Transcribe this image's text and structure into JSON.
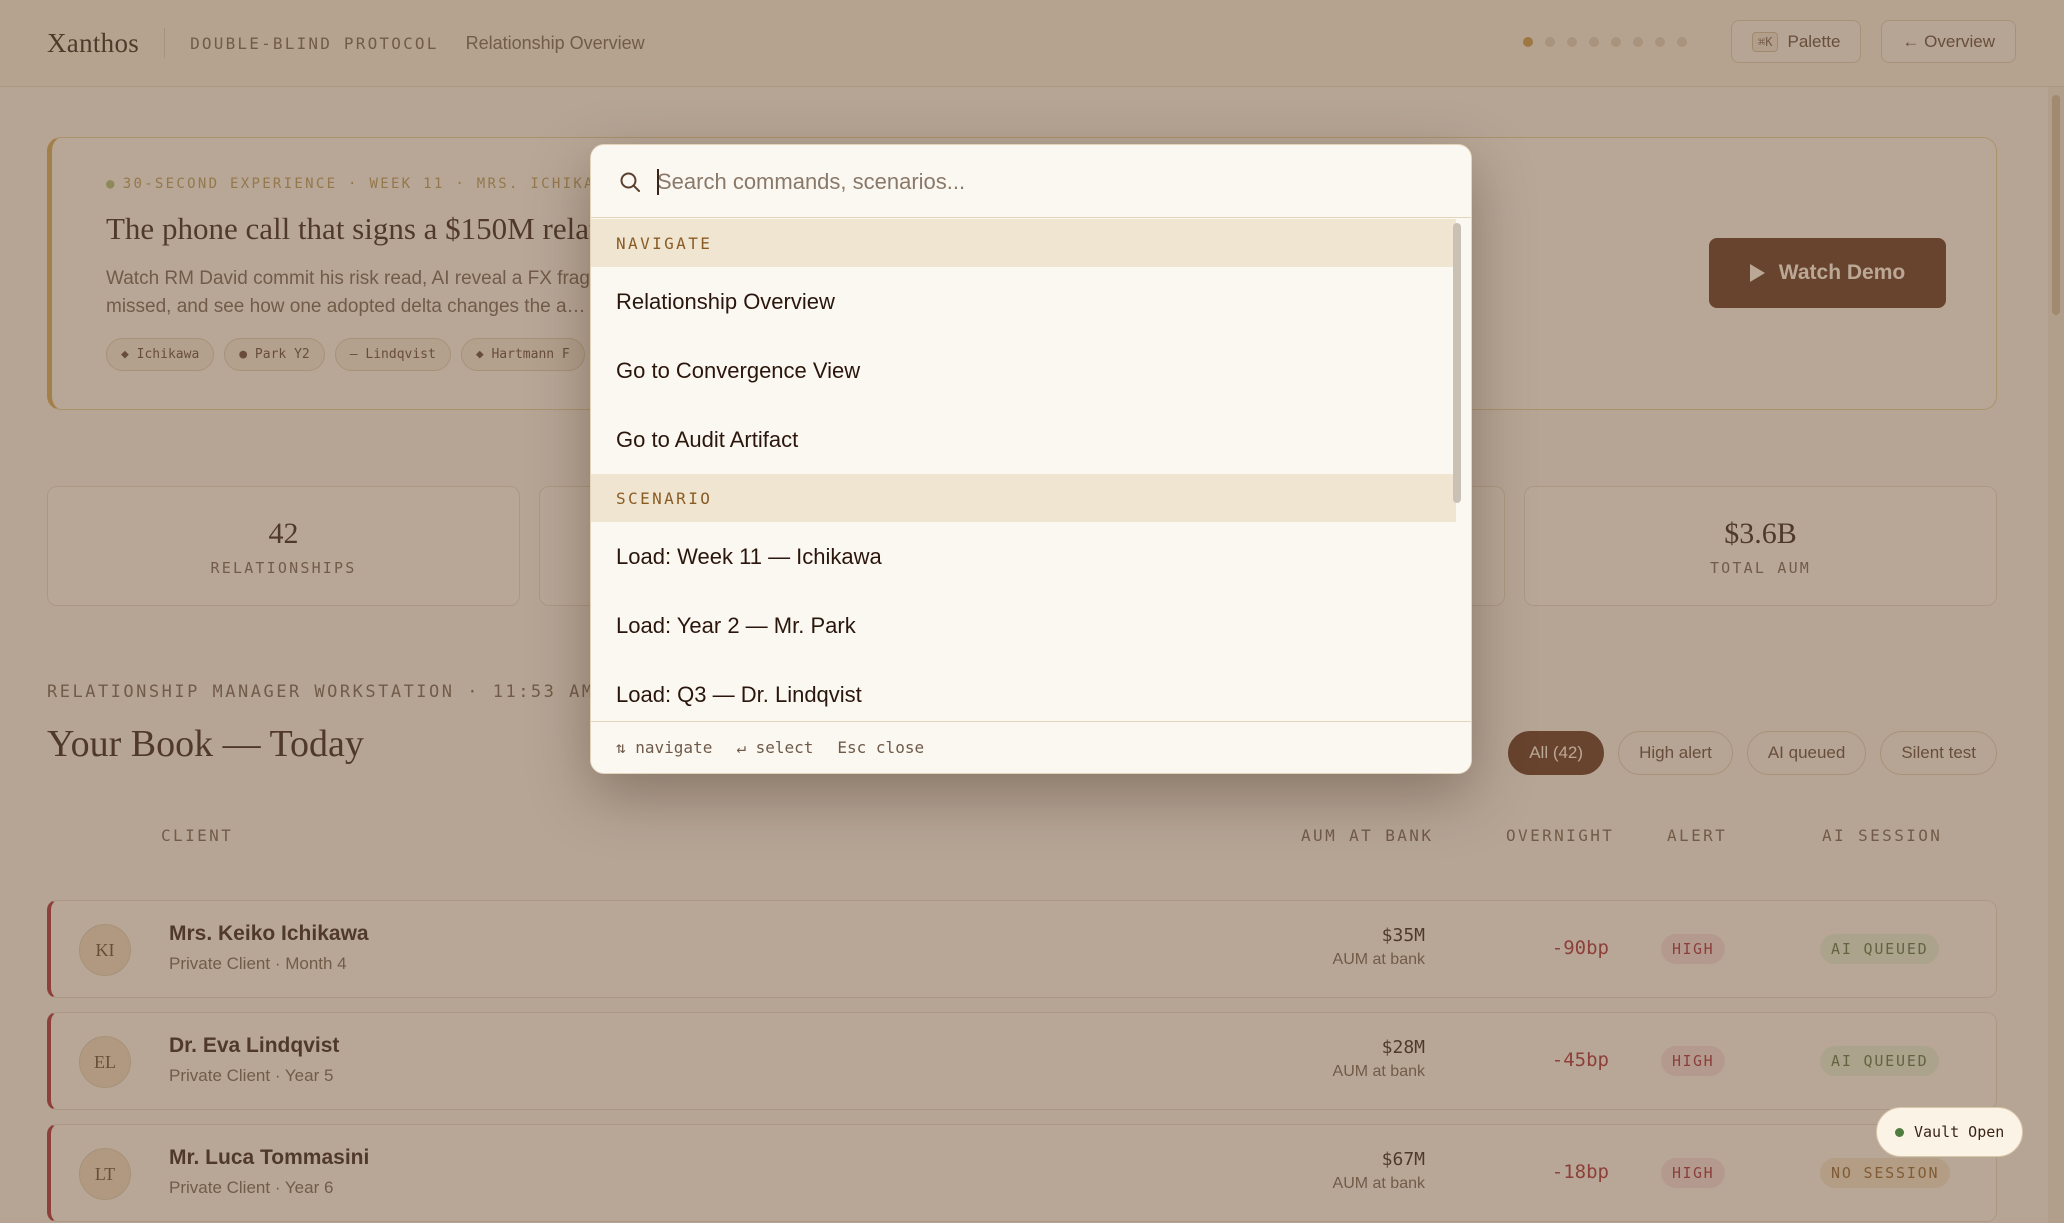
{
  "topbar": {
    "brand": "Xanthos",
    "protocol": "DOUBLE-BLIND PROTOCOL",
    "page": "Relationship Overview",
    "palette_kbd": "⌘K",
    "palette_label": "Palette",
    "overview_label": "← Overview",
    "progress": {
      "current": 1,
      "total": 8
    }
  },
  "hero": {
    "kicker": "30-SECOND EXPERIENCE · WEEK 11 · MRS. ICHIKAWA",
    "title": "The phone call that signs a $150M relationship",
    "description": "Watch RM David commit his risk read, AI reveal a FX fragility he missed, and see how one adopted delta changes the a…",
    "chips": [
      "◆ Ichikawa",
      "● Park Y2",
      "— Lindqvist",
      "◆ Hartmann F"
    ],
    "cta": "Watch Demo"
  },
  "stats": [
    {
      "value": "42",
      "label": "RELATIONSHIPS"
    },
    {
      "value": "$3.6B",
      "label": "TOTAL AUM"
    }
  ],
  "book": {
    "workstation_label": "RELATIONSHIP MANAGER WORKSTATION · 11:53 AM GMT",
    "title": "Your Book — Today",
    "filters": [
      "All (42)",
      "High alert",
      "AI queued",
      "Silent test"
    ],
    "columns": {
      "client": "CLIENT",
      "aum": "AUM AT BANK",
      "overnight": "OVERNIGHT",
      "alert": "ALERT",
      "ai_session": "AI SESSION"
    },
    "rows": [
      {
        "initials": "KI",
        "name": "Mrs. Keiko Ichikawa",
        "sub": "Private Client · Month 4",
        "aum": "$35M",
        "aum_sub": "AUM at bank",
        "overnight": "-90bp",
        "alert": "HIGH",
        "ai": "AI QUEUED"
      },
      {
        "initials": "EL",
        "name": "Dr. Eva Lindqvist",
        "sub": "Private Client · Year 5",
        "aum": "$28M",
        "aum_sub": "AUM at bank",
        "overnight": "-45bp",
        "alert": "HIGH",
        "ai": "AI QUEUED"
      },
      {
        "initials": "LT",
        "name": "Mr. Luca Tommasini",
        "sub": "Private Client · Year 6",
        "aum": "$67M",
        "aum_sub": "AUM at bank",
        "overnight": "-18bp",
        "alert": "HIGH",
        "ai": "NO SESSION"
      }
    ]
  },
  "vault": {
    "label": "Vault Open"
  },
  "palette": {
    "placeholder": "Search commands, scenarios...",
    "groups": [
      {
        "label": "NAVIGATE",
        "items": [
          "Relationship Overview",
          "Go to Convergence View",
          "Go to Audit Artifact"
        ]
      },
      {
        "label": "SCENARIO",
        "items": [
          "Load: Week 11 — Ichikawa",
          "Load: Year 2 — Mr. Park",
          "Load: Q3 — Dr. Lindqvist"
        ]
      }
    ],
    "footer": {
      "navigate": "⇅ navigate",
      "select": "↵ select",
      "close": "Esc close"
    }
  },
  "colors": {
    "accent": "#5a2b13",
    "alert": "#a4222b",
    "gold": "#d1a24d",
    "queued": "#4f6d39"
  }
}
